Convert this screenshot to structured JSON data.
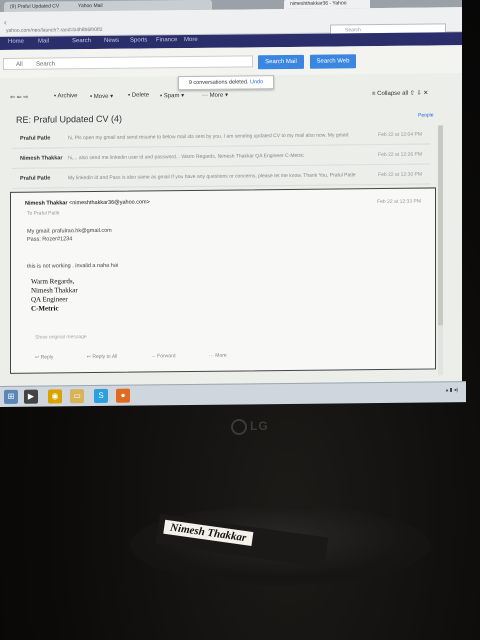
{
  "browser": {
    "tabs": [
      "(9) Praful Updated CV",
      "Yahoo Mail",
      "",
      "nimeshthakkar36 - Yahoo"
    ],
    "url": "yahoo.com/neo/launch?.rand=b4h8b6lfr0ff2",
    "search_placeholder": "Search"
  },
  "yahoo_nav": [
    "Home",
    "Mail",
    "Search",
    "News",
    "Sports",
    "Finance",
    "More"
  ],
  "search": {
    "scope": "All",
    "placeholder": "Search",
    "search_mail": "Search Mail",
    "search_web": "Search Web"
  },
  "toast": {
    "message": "9 conversations deleted.",
    "undo": "Undo"
  },
  "toolbar": {
    "archive": "Archive",
    "move": "Move",
    "delete": "Delete",
    "spam": "Spam",
    "more": "More",
    "collapse": "Collapse all"
  },
  "conversation": {
    "subject": "RE: Praful Updated CV (4)",
    "people": "People",
    "threads": [
      {
        "from": "Praful Patle",
        "snippet": "hi, Pls open my gmail and send resume to below mail ids sent by you. I am sending updated CV to my mail also now. My gmail:",
        "date": "Feb 22 at 12:04 PM"
      },
      {
        "from": "Nimesh Thakkar",
        "snippet": "hi,... also send me linkedin user id and password... Warm Regards, Nimesh Thakkar QA Engineer C-Metric",
        "date": "Feb 22 at 12:26 PM"
      },
      {
        "from": "Praful Patle",
        "snippet": "My linkedin id and Pass is also same as gmail If you have any questions or concerns, please let me know. Thank You, Praful Patle",
        "date": "Feb 22 at 12:30 PM"
      }
    ],
    "open_message": {
      "from_name": "Nimesh Thakkar",
      "from_email": "<nimeshthakkar36@yahoo.com>",
      "to": "To  Praful Patle",
      "date": "Feb 22 at 12:33 PM",
      "lines": [
        "My gmail: prafulrao.hk@gmail.com",
        "Pass: Rozer#1234",
        "",
        "this is not working . invalid a naha hai"
      ],
      "signature": [
        "Warm Regards,",
        "Nimesh Thakkar",
        "QA Engineer",
        "C-Metric"
      ],
      "show_original": "Show original message",
      "actions": [
        "Reply",
        "Reply to All",
        "Forward",
        "More"
      ]
    }
  },
  "monitor": {
    "brand": "LG",
    "nameplate": "Nimesh Thakkar"
  },
  "colors": {
    "yahoo_purple": "#2a2e6b",
    "button_blue": "#3b86e0",
    "screen_bg": "#eceeea",
    "room_dark": "#0e0d0b"
  }
}
